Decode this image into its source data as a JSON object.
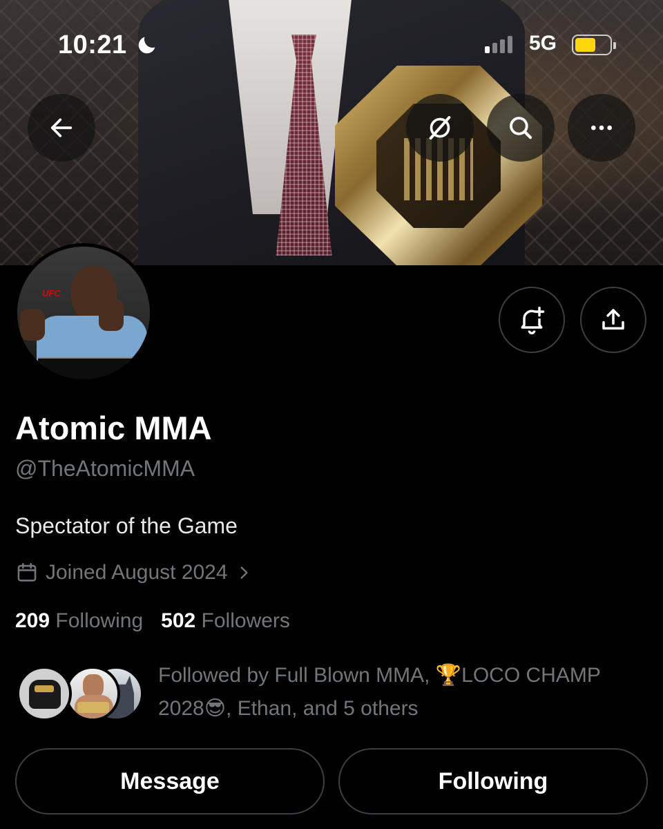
{
  "status_bar": {
    "time": "10:21",
    "focus_icon": "moon-icon",
    "signal_bars_active": 1,
    "network": "5G",
    "battery_level": 0.6,
    "battery_color": "#ffd60a"
  },
  "banner": {
    "back_icon": "arrow-left-icon",
    "grok_icon": "grok-icon",
    "search_icon": "search-icon",
    "more_icon": "more-icon"
  },
  "actions": {
    "notify_icon": "bell-plus-icon",
    "share_icon": "share-icon"
  },
  "profile": {
    "display_name": "Atomic MMA",
    "handle": "@TheAtomicMMA",
    "bio": "Spectator of the Game",
    "joined": "Joined August 2024",
    "following_count": "209",
    "following_label": "Following",
    "followers_count": "502",
    "followers_label": "Followers"
  },
  "followed_by": {
    "prefix": "Followed by Full Blown MMA, ",
    "trophy": "🏆",
    "name2": "LOCO CHAMP 2028",
    "emoji": "😎",
    "suffix": ", Ethan, and 5 others"
  },
  "buttons": {
    "message_label": "Message",
    "following_label": "Following"
  },
  "colors": {
    "background": "#000000",
    "primary_text": "#e7e9ea",
    "secondary_text": "#71767b",
    "border": "#3b3f44"
  }
}
